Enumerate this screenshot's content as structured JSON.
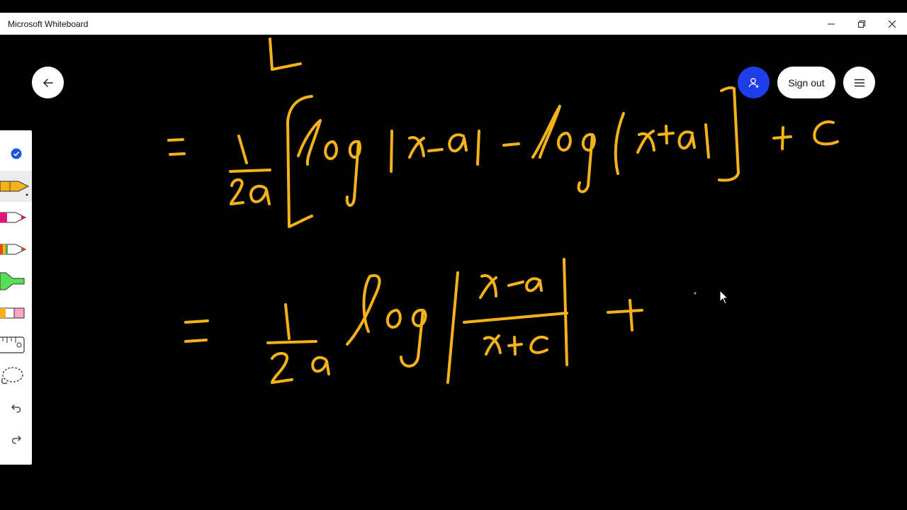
{
  "window": {
    "title": "Microsoft Whiteboard",
    "minimize_glyph": "—",
    "controls": [
      "minimize-icon",
      "restore-icon",
      "close-icon"
    ]
  },
  "header": {
    "signout_label": "Sign out",
    "buttons": [
      "back-arrow-icon",
      "add-person-icon",
      "hamburger-menu-icon"
    ]
  },
  "toolbar": {
    "tools": [
      {
        "name": "select-check-icon",
        "color": "#1a56db"
      },
      {
        "name": "yellow-pen-icon",
        "color": "#f6b21a",
        "selected": true
      },
      {
        "name": "pink-pen-icon",
        "color": "#e6127a"
      },
      {
        "name": "multicolor-pen-icon",
        "color": "#e24b1c"
      },
      {
        "name": "highlighter-icon",
        "color": "#58e05a"
      },
      {
        "name": "eraser-icon",
        "color": "#f6a7c0"
      },
      {
        "name": "ruler-icon",
        "color": "#333333"
      },
      {
        "name": "lasso-icon",
        "color": "#333333"
      },
      {
        "name": "undo-icon",
        "color": "#333333"
      },
      {
        "name": "redo-icon",
        "color": "#333333"
      }
    ]
  },
  "canvas": {
    "ink_color": "#f6b21a",
    "background": "#000000",
    "equation_line_1": "= 1/2a [ log |x-a| - log |x+a| ] + c",
    "equation_line_2": "= 1/2a log | x-a / x+c | + "
  }
}
